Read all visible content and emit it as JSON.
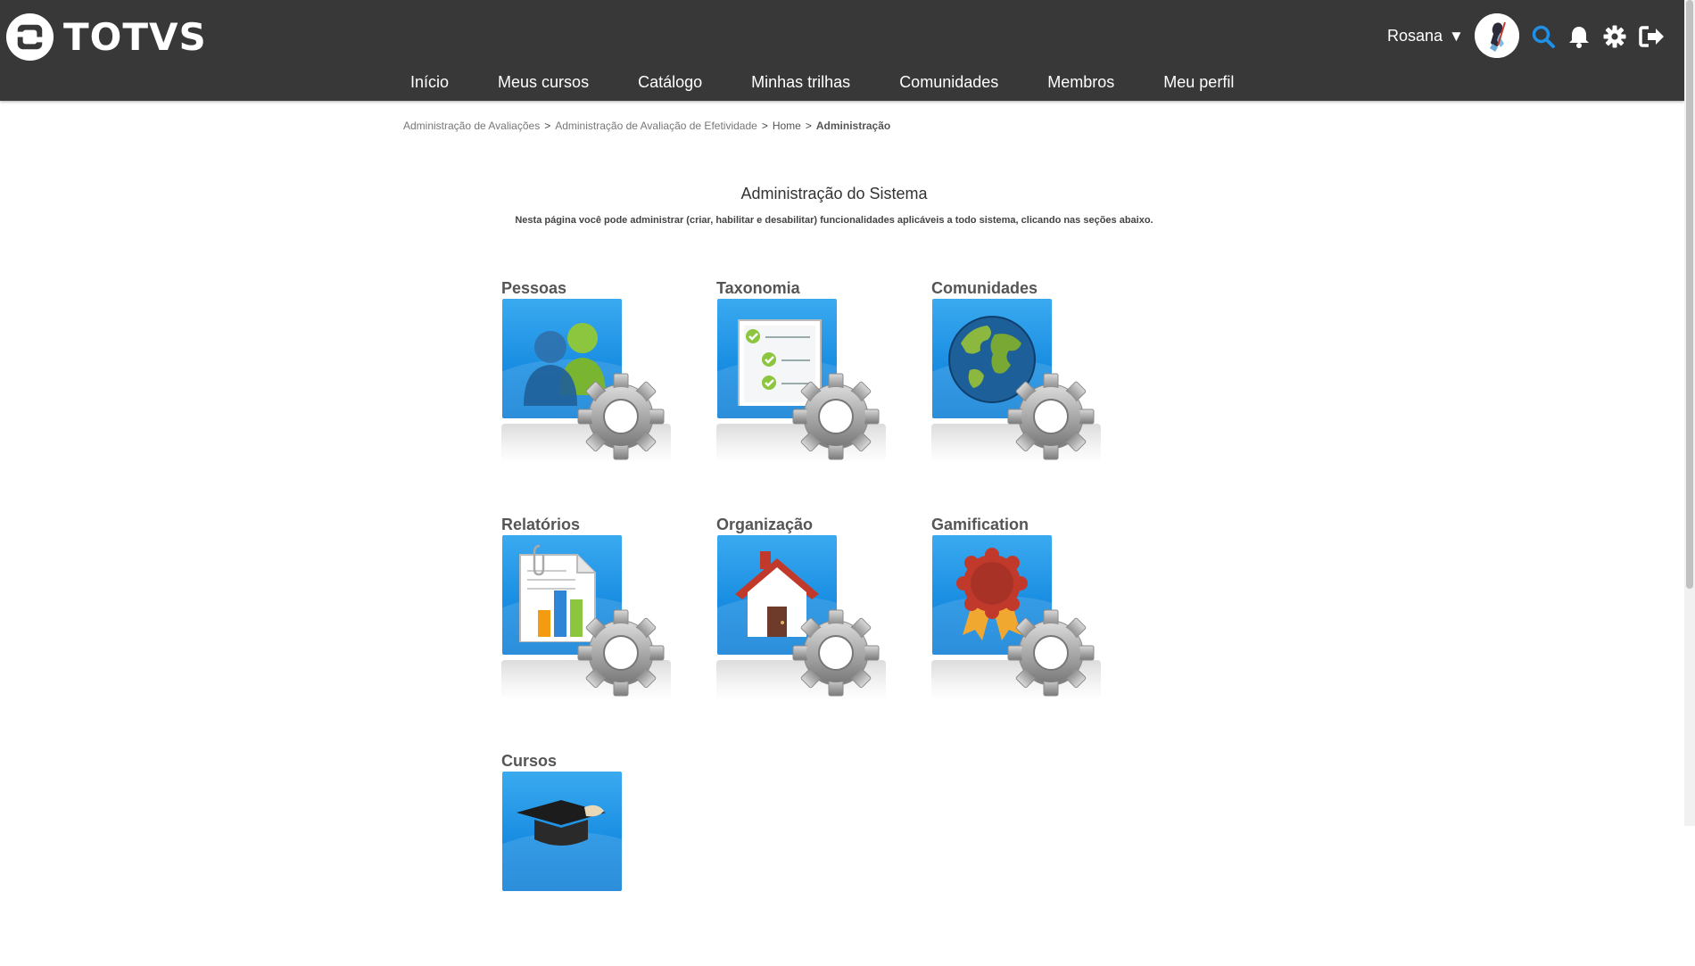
{
  "header": {
    "logo_text": "TOTVS",
    "user_name": "Rosana",
    "user_caret": "▼",
    "icons": [
      "search-icon",
      "bell-icon",
      "gear-icon",
      "logout-icon"
    ],
    "accent_color": "#1e90e8"
  },
  "nav": {
    "items": [
      "Início",
      "Meus cursos",
      "Catálogo",
      "Minhas trilhas",
      "Comunidades",
      "Membros",
      "Meu perfil"
    ]
  },
  "breadcrumb": {
    "items": [
      "Administração de Avaliações",
      "Administração de Avaliação de Efetividade",
      "Home"
    ],
    "separator": ">",
    "current": "Administração"
  },
  "page": {
    "title": "Administração do Sistema",
    "description": "Nesta página você pode administrar (criar, habilitar e desabilitar) funcionalidades aplicáveis a todo sistema, clicando nas seções abaixo."
  },
  "sections": [
    {
      "label": "Pessoas",
      "icon": "people-icon"
    },
    {
      "label": "Taxonomia",
      "icon": "checklist-icon"
    },
    {
      "label": "Comunidades",
      "icon": "globe-icon"
    },
    {
      "label": "Relatórios",
      "icon": "report-chart-icon"
    },
    {
      "label": "Organização",
      "icon": "house-icon"
    },
    {
      "label": "Gamification",
      "icon": "award-ribbon-icon"
    },
    {
      "label": "Cursos",
      "icon": "graduation-cap-icon"
    }
  ]
}
